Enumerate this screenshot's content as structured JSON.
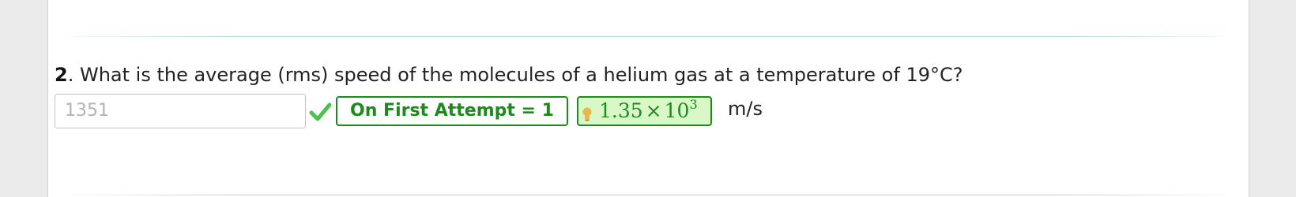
{
  "question": {
    "number": "2",
    "text": ". What is the average (rms) speed of the molecules of a helium gas at a temperature of 19°C?"
  },
  "answer": {
    "value": "1351"
  },
  "feedback": {
    "attempt_label": "On First Attempt = 1",
    "correct_mantissa": "1.35",
    "times": "×",
    "correct_base": "10",
    "correct_exponent": "3"
  },
  "units": "m/s",
  "colors": {
    "correct_green": "#1c8a1c",
    "correct_background": "#d9f7c7",
    "checkmark": "#4cc14c",
    "hint_bulb": "#e8b84a"
  },
  "icons": {
    "check": "check-icon",
    "hint": "lightbulb-icon"
  }
}
